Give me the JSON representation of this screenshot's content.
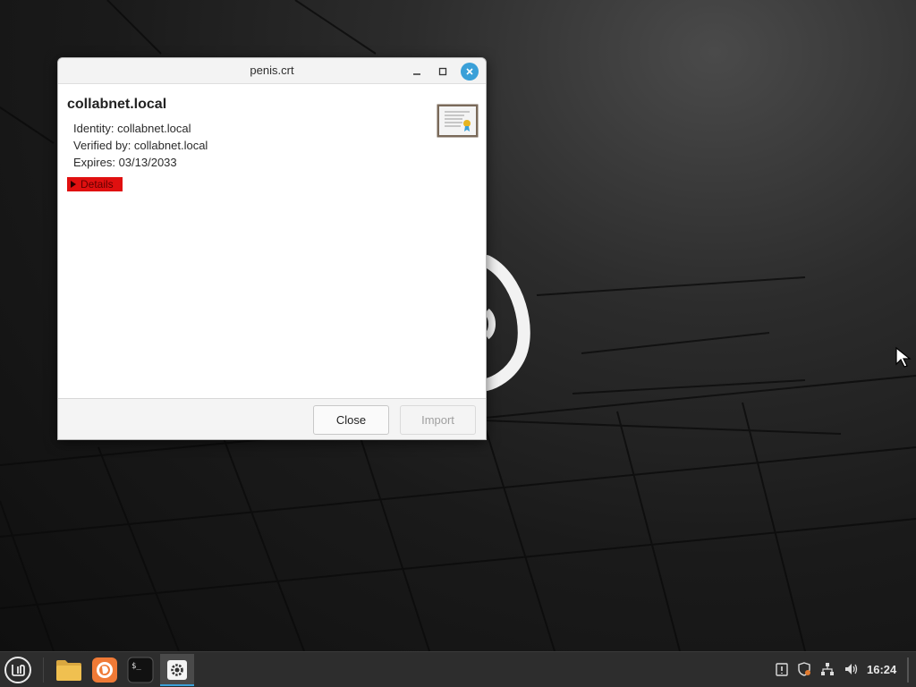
{
  "window": {
    "title": "penis.crt",
    "minimize_icon": "minimize-icon",
    "maximize_icon": "maximize-icon",
    "close_icon": "close-icon"
  },
  "certificate": {
    "name": "collabnet.local",
    "identity": "Identity: collabnet.local",
    "verified_by": "Verified by: collabnet.local",
    "expires": "Expires: 03/13/2033",
    "details_label": "Details",
    "icon": "certificate-icon"
  },
  "buttons": {
    "close": "Close",
    "import": "Import"
  },
  "taskbar": {
    "apps": [
      "menu-icon",
      "files-icon",
      "firefox-icon",
      "terminal-icon",
      "settings-icon"
    ],
    "clock": "16:24"
  },
  "colors": {
    "accent": "#3aa0d8",
    "details_highlight": "#e01010"
  }
}
